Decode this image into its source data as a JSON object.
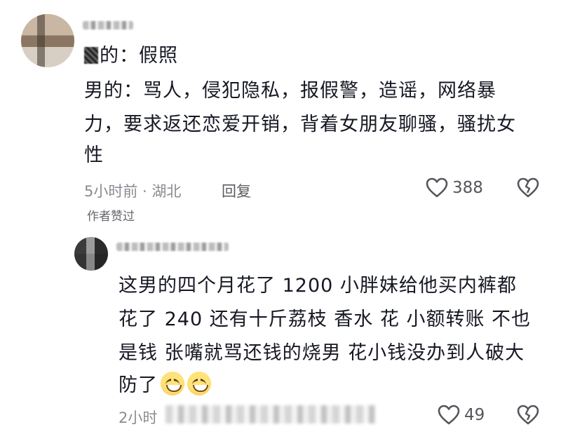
{
  "comment": {
    "content_line1": "的：假照",
    "content_line2": "男的：骂人，侵犯隐私，报假警，造谣，网络暴",
    "content_line3": "力，要求返还恋爱开销，背着女朋友聊骚，骚扰女",
    "content_line4": "性",
    "time_location": "5小时前 · 湖北",
    "reply_label": "回复",
    "like_count": "388",
    "author_liked": "作者赞过"
  },
  "reply": {
    "content_line1": "这男的四个月花了 1200 小胖妹给他买内裤都",
    "content_line2": "花了 240 还有十斤荔枝 香水 花 小额转账 不也",
    "content_line3": "是钱 张嘴就骂还钱的烧男 花小钱没办到人破大",
    "content_line4": "防了",
    "time_prefix": "2小时",
    "like_count": "49"
  },
  "icons": {
    "like": "heart-outline-icon",
    "dislike": "broken-heart-icon",
    "emoji": "grinning-face-emoji"
  },
  "colors": {
    "text": "#161823",
    "meta": "#8a8b91",
    "icon": "#55565c"
  }
}
